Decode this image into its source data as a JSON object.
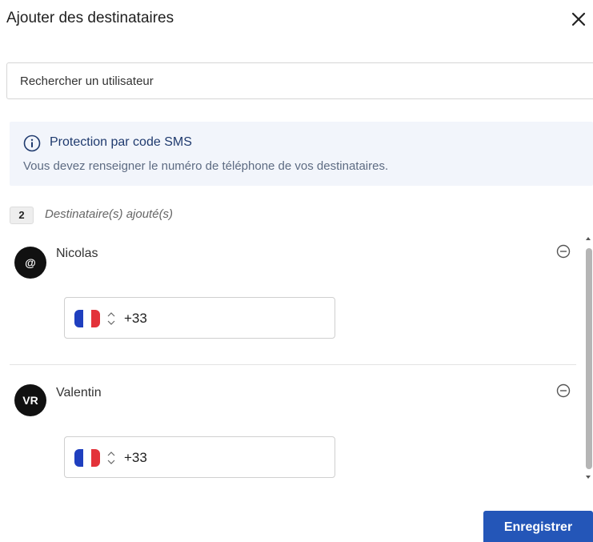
{
  "modal": {
    "title": "Ajouter des destinataires",
    "close_icon": "close-icon"
  },
  "search": {
    "placeholder": "Rechercher un utilisateur",
    "value": ""
  },
  "info": {
    "icon": "info-icon",
    "title": "Protection par code SMS",
    "text": "Vous devez renseigner le numéro de téléphone de vos destinataires."
  },
  "recipients_summary": {
    "count": "2",
    "label": "Destinataire(s) ajouté(s)"
  },
  "recipients": [
    {
      "avatar_text": "@",
      "name": "Nicolas",
      "country_flag": "france-flag-icon",
      "dial_code": "+33"
    },
    {
      "avatar_text": "VR",
      "name": "Valentin",
      "country_flag": "france-flag-icon",
      "dial_code": "+33"
    }
  ],
  "colors": {
    "primary": "#2456b8",
    "info_bg": "#f2f5fb",
    "flag_blue": "#1f3fbf",
    "flag_white": "#ffffff",
    "flag_red": "#e3323a"
  },
  "footer": {
    "save_label": "Enregistrer"
  }
}
